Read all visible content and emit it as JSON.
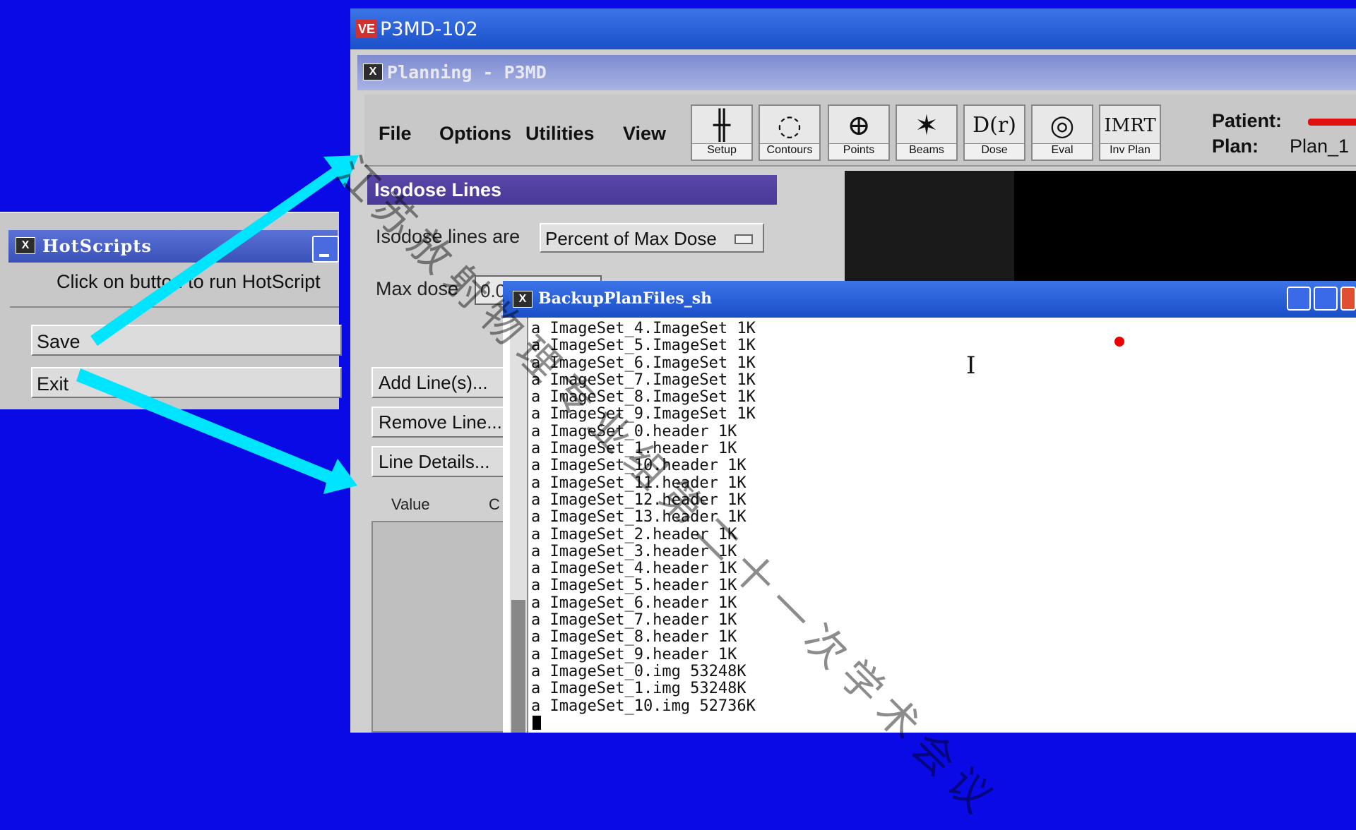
{
  "colors": {
    "background": "#0a0ae6",
    "arrow": "#00e5ff"
  },
  "hotscripts": {
    "title": "HotScripts",
    "prompt": "Click on button to run HotScript",
    "buttons": [
      "Save",
      "Exit"
    ]
  },
  "p3md": {
    "title": "P3MD-102",
    "logo": "VE",
    "subtitle": "Planning - P3MD",
    "menu": [
      "File",
      "Options",
      "Utilities",
      "View"
    ],
    "tools": [
      {
        "label": "Setup",
        "icon": "setup-icon",
        "glyph": "╫"
      },
      {
        "label": "Contours",
        "icon": "contours-icon",
        "glyph": "◌"
      },
      {
        "label": "Points",
        "icon": "points-icon",
        "glyph": "⊕"
      },
      {
        "label": "Beams",
        "icon": "beams-icon",
        "glyph": "✶"
      },
      {
        "label": "Dose",
        "icon": "dose-icon",
        "glyph": "D(r)"
      },
      {
        "label": "Eval",
        "icon": "eval-icon",
        "glyph": "◎"
      },
      {
        "label": "Inv Plan",
        "icon": "inv-plan-icon",
        "glyph": "IMRT"
      }
    ],
    "patient_label": "Patient:",
    "plan_label": "Plan:",
    "plan_value": "Plan_1"
  },
  "isodose": {
    "header": "Isodose Lines",
    "lines_are_label": "Isodose lines are",
    "lines_are_value": "Percent of Max Dose",
    "max_dose_label": "Max dose",
    "max_dose_value": "0.0",
    "buttons": [
      "Add Line(s)...",
      "Remove Line...",
      "Line Details..."
    ],
    "col_value": "Value",
    "col_color": "C"
  },
  "backup": {
    "title": "BackupPlanFiles_sh",
    "lines": [
      "a ImageSet_4.ImageSet 1K",
      "a ImageSet_5.ImageSet 1K",
      "a ImageSet_6.ImageSet 1K",
      "a ImageSet_7.ImageSet 1K",
      "a ImageSet_8.ImageSet 1K",
      "a ImageSet_9.ImageSet 1K",
      "a ImageSet_0.header 1K",
      "a ImageSet_1.header 1K",
      "a ImageSet_10.header 1K",
      "a ImageSet_11.header 1K",
      "a ImageSet_12.header 1K",
      "a ImageSet_13.header 1K",
      "a ImageSet_2.header 1K",
      "a ImageSet_3.header 1K",
      "a ImageSet_4.header 1K",
      "a ImageSet_5.header 1K",
      "a ImageSet_6.header 1K",
      "a ImageSet_7.header 1K",
      "a ImageSet_8.header 1K",
      "a ImageSet_9.header 1K",
      "a ImageSet_0.img 53248K",
      "a ImageSet_1.img 53248K",
      "a ImageSet_10.img 52736K"
    ]
  },
  "watermark": "江苏放射物理专业组第二十一次学术会议"
}
